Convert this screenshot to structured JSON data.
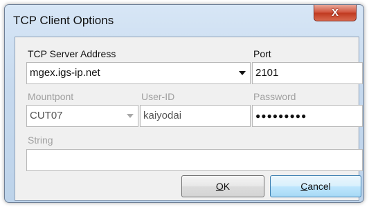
{
  "window": {
    "title": "TCP Client Options",
    "close_label": "X"
  },
  "server": {
    "label": "TCP Server Address",
    "value": "mgex.igs-ip.net"
  },
  "port": {
    "label": "Port",
    "value": "2101"
  },
  "mountpoint": {
    "label": "Mountpont",
    "value": "CUT07"
  },
  "user": {
    "label": "User-ID",
    "value": "kaiyodai"
  },
  "password": {
    "label": "Password",
    "value": "●●●●●●●●●"
  },
  "string": {
    "label": "String",
    "value": ""
  },
  "buttons": {
    "ok_underline": "O",
    "ok_rest": "K",
    "cancel_underline": "C",
    "cancel_rest": "ancel"
  }
}
